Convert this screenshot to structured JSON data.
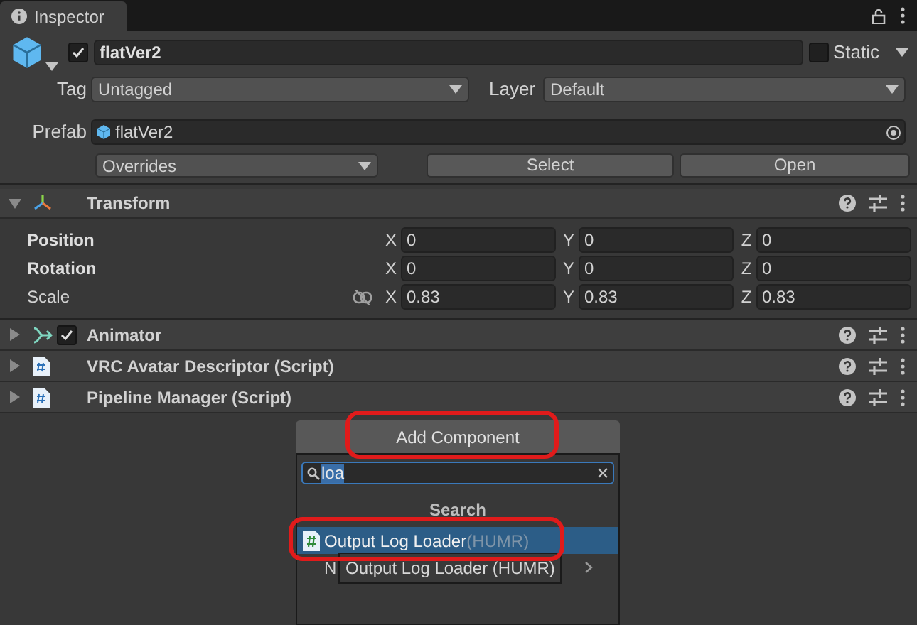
{
  "tab": {
    "title": "Inspector"
  },
  "object": {
    "name": "flatVer2",
    "active": true,
    "static_label": "Static",
    "static": false,
    "tag_label": "Tag",
    "tag": "Untagged",
    "layer_label": "Layer",
    "layer": "Default"
  },
  "prefab": {
    "label": "Prefab",
    "asset": "flatVer2",
    "overrides": "Overrides",
    "buttons": [
      "Select",
      "Open"
    ]
  },
  "transform": {
    "title": "Transform",
    "expanded": true,
    "rows": [
      {
        "label": "Position",
        "bold": true,
        "link": false,
        "values": [
          {
            "axis": "X",
            "value": "0"
          },
          {
            "axis": "Y",
            "value": "0"
          },
          {
            "axis": "Z",
            "value": "0"
          }
        ]
      },
      {
        "label": "Rotation",
        "bold": true,
        "link": false,
        "values": [
          {
            "axis": "X",
            "value": "0"
          },
          {
            "axis": "Y",
            "value": "0"
          },
          {
            "axis": "Z",
            "value": "0"
          }
        ]
      },
      {
        "label": "Scale",
        "bold": false,
        "link": true,
        "values": [
          {
            "axis": "X",
            "value": "0.83"
          },
          {
            "axis": "Y",
            "value": "0.83"
          },
          {
            "axis": "Z",
            "value": "0.83"
          }
        ]
      }
    ]
  },
  "components": [
    {
      "kind": "animator",
      "title": "Animator",
      "expanded": false,
      "enabled": true
    },
    {
      "kind": "script",
      "title": "VRC Avatar Descriptor (Script)",
      "expanded": false
    },
    {
      "kind": "script",
      "title": "Pipeline Manager (Script)",
      "expanded": false
    }
  ],
  "add_component": {
    "button": "Add Component",
    "search": "loa",
    "header": "Search",
    "results": [
      {
        "name": "Output Log Loader",
        "suffix": "(HUMR)",
        "selected": true
      },
      {
        "name": "N",
        "submenu": true,
        "selected": false
      }
    ],
    "tooltip": "Output Log Loader (HUMR)"
  }
}
